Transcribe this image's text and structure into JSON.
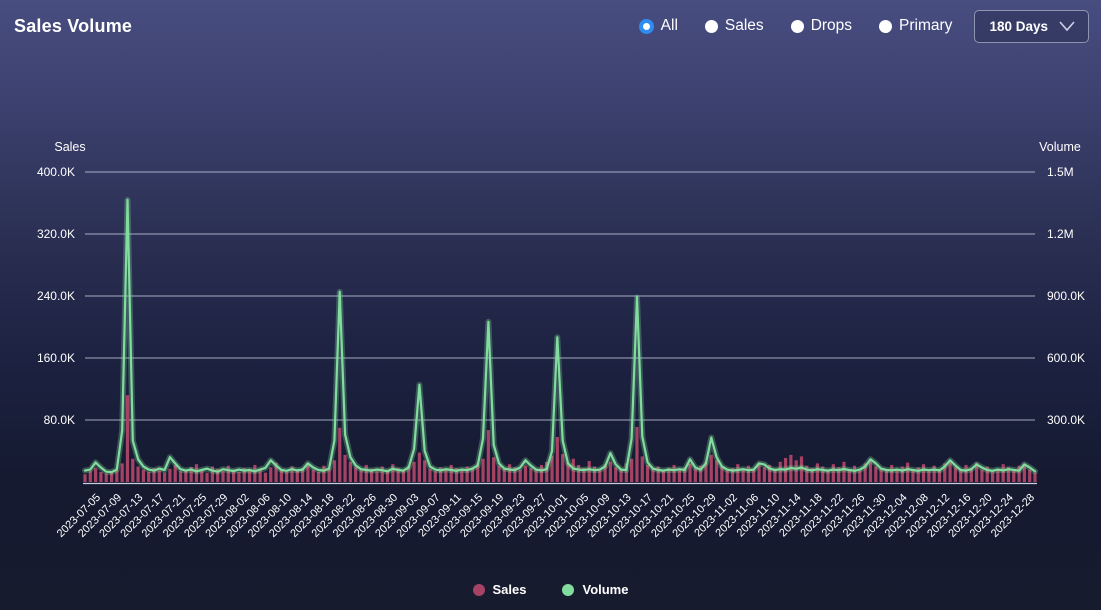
{
  "header": {
    "title": "Sales Volume",
    "filters": [
      {
        "label": "All",
        "selected": true
      },
      {
        "label": "Sales",
        "selected": false
      },
      {
        "label": "Drops",
        "selected": false
      },
      {
        "label": "Primary",
        "selected": false
      }
    ],
    "range_dropdown": {
      "value": "180 Days"
    }
  },
  "colors": {
    "accent_radio": "#2e8df2",
    "bar_sales": "#a64264",
    "line_volume": "#82dc9d",
    "gridline": "#c7cce0",
    "axis_line": "#d3d7e8",
    "text": "#ffffff"
  },
  "chart_data": {
    "type": "bar+line",
    "title": "Sales Volume",
    "grid": true,
    "units_note": "values_k are thousands: sales 112 = 112.0K, volume 1365 = 1.365M (estimated from gridlines)",
    "left_axis": {
      "title": "Sales",
      "min": 0,
      "max_k": 400,
      "ticks": [
        "400.0K",
        "320.0K",
        "240.0K",
        "160.0K",
        "80.0K"
      ],
      "tick_values_k": [
        400,
        320,
        240,
        160,
        80
      ]
    },
    "right_axis": {
      "title": "Volume",
      "min": 0,
      "max_k": 1500,
      "ticks": [
        "1.5M",
        "1.2M",
        "900.0K",
        "600.0K",
        "300.0K"
      ],
      "tick_values_k": [
        1500,
        1200,
        900,
        600,
        300
      ]
    },
    "x_tick_labels": [
      "2023-07-05",
      "2023-07-09",
      "2023-07-13",
      "2023-07-17",
      "2023-07-21",
      "2023-07-25",
      "2023-07-29",
      "2023-08-02",
      "2023-08-06",
      "2023-08-10",
      "2023-08-14",
      "2023-08-18",
      "2023-08-22",
      "2023-08-26",
      "2023-08-30",
      "2023-09-03",
      "2023-09-07",
      "2023-09-11",
      "2023-09-15",
      "2023-09-19",
      "2023-09-23",
      "2023-09-27",
      "2023-10-01",
      "2023-10-05",
      "2023-10-09",
      "2023-10-13",
      "2023-10-17",
      "2023-10-21",
      "2023-10-25",
      "2023-10-29",
      "2023-11-02",
      "2023-11-06",
      "2023-11-10",
      "2023-11-14",
      "2023-11-18",
      "2023-11-22",
      "2023-11-26",
      "2023-11-30",
      "2023-12-04",
      "2023-12-08",
      "2023-12-12",
      "2023-12-16",
      "2023-12-20",
      "2023-12-24",
      "2023-12-28"
    ],
    "x_tick_start_index": 3,
    "x_tick_step": 4,
    "legend": {
      "position": "bottom",
      "items": [
        "Sales",
        "Volume"
      ]
    },
    "series": [
      {
        "name": "Sales",
        "type": "bar",
        "axis": "left",
        "color": "#a64264",
        "values_k": [
          10,
          14,
          18,
          13,
          11,
          12,
          15,
          24,
          112,
          30,
          20,
          16,
          13,
          18,
          15,
          12,
          17,
          22,
          14,
          16,
          19,
          23,
          15,
          12,
          20,
          17,
          14,
          21,
          16,
          13,
          18,
          14,
          22,
          16,
          12,
          19,
          25,
          17,
          13,
          20,
          15,
          18,
          24,
          16,
          13,
          21,
          17,
          28,
          70,
          35,
          26,
          19,
          15,
          22,
          17,
          14,
          20,
          16,
          23,
          18,
          15,
          21,
          26,
          38,
          28,
          17,
          14,
          19,
          16,
          22,
          18,
          15,
          20,
          17,
          24,
          30,
          67,
          32,
          21,
          17,
          23,
          19,
          16,
          21,
          18,
          15,
          22,
          26,
          34,
          58,
          36,
          25,
          30,
          22,
          18,
          27,
          20,
          16,
          23,
          26,
          19,
          16,
          24,
          30,
          71,
          33,
          22,
          17,
          20,
          15,
          18,
          22,
          16,
          19,
          24,
          17,
          21,
          26,
          35,
          28,
          20,
          15,
          18,
          23,
          17,
          21,
          16,
          24,
          19,
          22,
          17,
          26,
          31,
          35,
          28,
          33,
          21,
          18,
          24,
          20,
          16,
          23,
          19,
          26,
          15,
          21,
          17,
          24,
          28,
          20,
          18,
          15,
          22,
          17,
          20,
          25,
          16,
          19,
          23,
          14,
          21,
          17,
          24,
          27,
          19,
          15,
          22,
          18,
          25,
          16,
          20,
          14,
          17,
          23,
          19,
          15,
          21,
          24,
          16,
          12
        ]
      },
      {
        "name": "Volume",
        "type": "line",
        "axis": "right",
        "color": "#82dc9d",
        "values_k": [
          55,
          60,
          95,
          70,
          50,
          48,
          60,
          250,
          1365,
          200,
          110,
          75,
          60,
          55,
          65,
          58,
          120,
          90,
          62,
          55,
          60,
          52,
          58,
          65,
          55,
          50,
          62,
          57,
          53,
          60,
          55,
          58,
          52,
          60,
          68,
          105,
          80,
          58,
          54,
          62,
          56,
          60,
          90,
          70,
          58,
          55,
          65,
          200,
          920,
          230,
          120,
          80,
          62,
          58,
          55,
          60,
          57,
          52,
          64,
          58,
          55,
          70,
          160,
          470,
          150,
          75,
          60,
          56,
          62,
          58,
          54,
          60,
          57,
          65,
          80,
          210,
          775,
          180,
          90,
          65,
          60,
          58,
          70,
          105,
          80,
          60,
          56,
          62,
          150,
          700,
          200,
          90,
          65,
          60,
          58,
          62,
          57,
          60,
          75,
          140,
          85,
          60,
          58,
          210,
          893,
          220,
          95,
          65,
          58,
          55,
          60,
          57,
          62,
          58,
          110,
          70,
          60,
          90,
          215,
          120,
          75,
          60,
          55,
          58,
          62,
          57,
          60,
          90,
          85,
          65,
          58,
          62,
          60,
          68,
          64,
          70,
          60,
          56,
          62,
          58,
          55,
          60,
          57,
          63,
          58,
          54,
          60,
          75,
          110,
          90,
          65,
          58,
          56,
          60,
          55,
          62,
          58,
          54,
          60,
          57,
          60,
          56,
          75,
          105,
          80,
          58,
          55,
          62,
          85,
          70,
          58,
          54,
          60,
          56,
          62,
          58,
          55,
          85,
          70,
          52
        ]
      }
    ]
  }
}
